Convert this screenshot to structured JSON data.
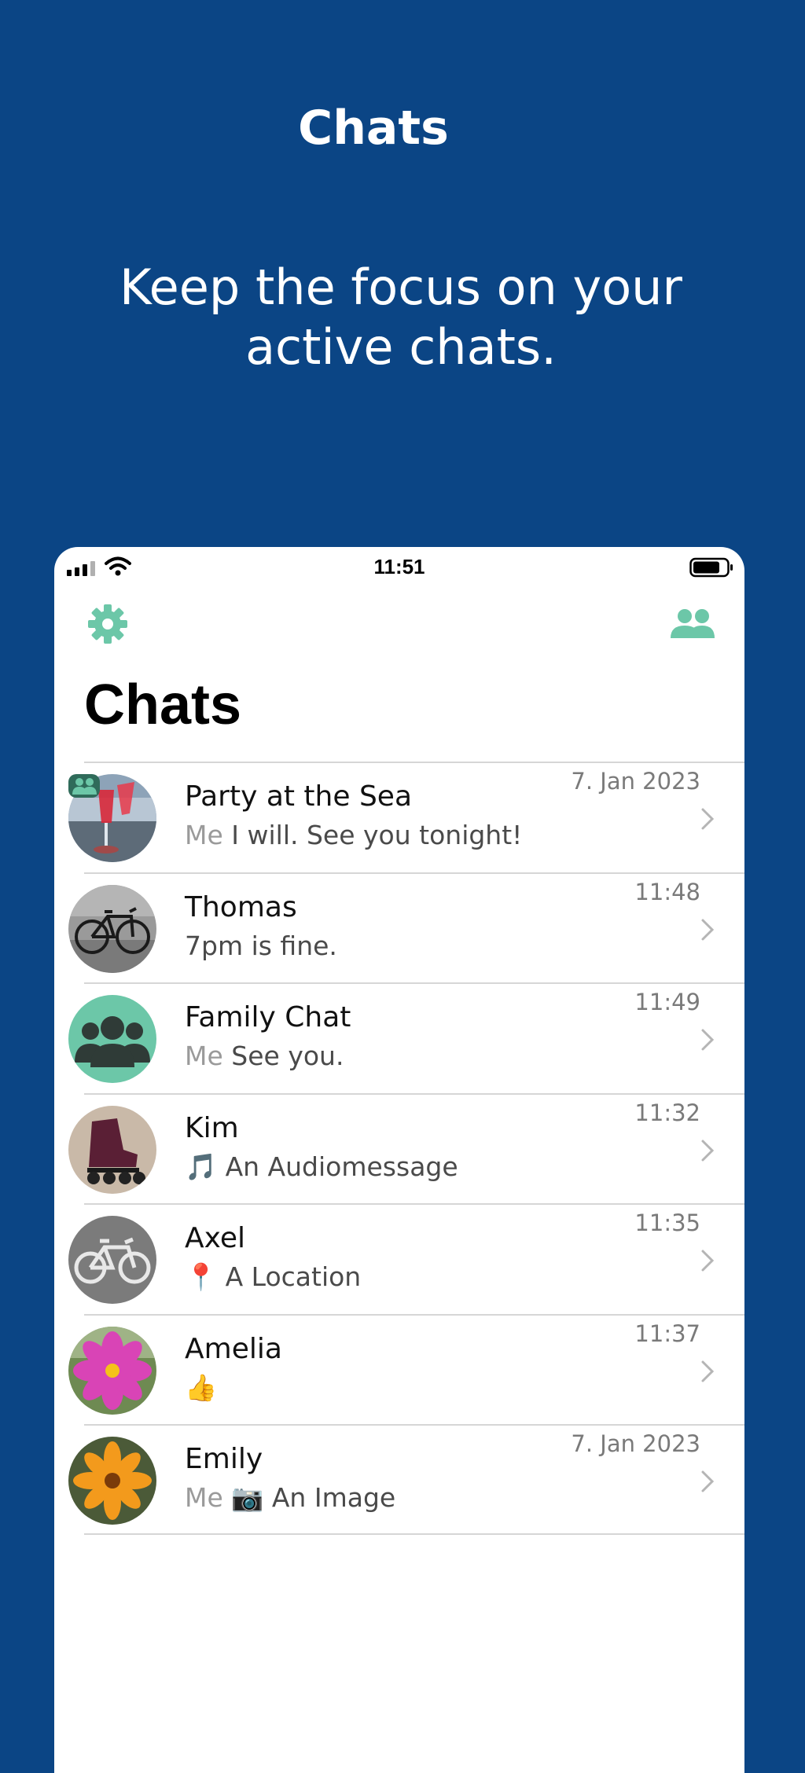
{
  "promo": {
    "title": "Chats",
    "subtitle": "Keep the focus on your active chats."
  },
  "statusbar": {
    "time": "11:51",
    "icons": [
      "signal-icon",
      "wifi-icon",
      "battery-icon"
    ]
  },
  "toolbar": {
    "settings_icon": "gear-icon",
    "contacts_icon": "people-icon",
    "accent": "#6cc7a8"
  },
  "screen": {
    "title": "Chats"
  },
  "chats": [
    {
      "name": "Party at the Sea",
      "me": "Me",
      "preview": "I will. See you tonight!",
      "time": "7. Jan 2023",
      "group": true
    },
    {
      "name": "Thomas",
      "me": "",
      "preview": "7pm is fine.",
      "time": "11:48",
      "group": false
    },
    {
      "name": "Family Chat",
      "me": "Me",
      "preview": "See you.",
      "time": "11:49",
      "group": true
    },
    {
      "name": "Kim",
      "me": "",
      "preview": "🎵 An Audiomessage",
      "time": "11:32",
      "group": false
    },
    {
      "name": "Axel",
      "me": "",
      "preview": "📍 A Location",
      "time": "11:35",
      "group": false
    },
    {
      "name": "Amelia",
      "me": "",
      "preview": "👍",
      "time": "11:37",
      "group": false
    },
    {
      "name": "Emily",
      "me": "Me",
      "preview": "📷 An Image",
      "time": "7. Jan 2023",
      "group": false
    }
  ]
}
